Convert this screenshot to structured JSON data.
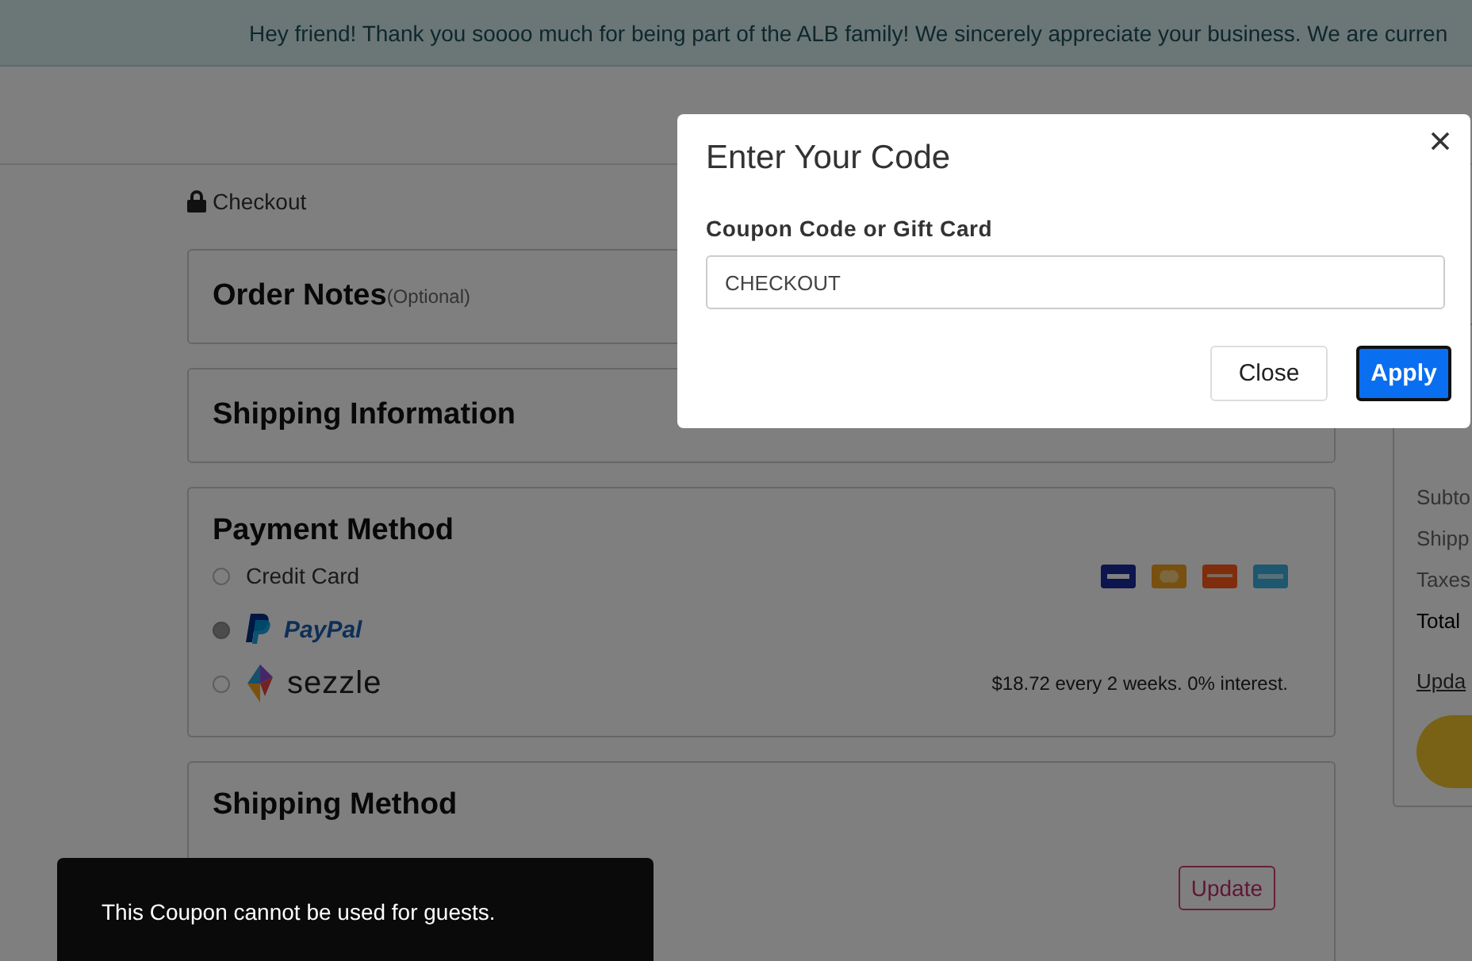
{
  "banner": {
    "text": "Hey friend! Thank you soooo much for being part of the ALB family! We sincerely appreciate your business. We are curren"
  },
  "breadcrumb": {
    "label": "Checkout"
  },
  "sections": [
    {
      "kind": "notes",
      "title": "Order Notes",
      "note": "(Optional)"
    },
    {
      "kind": "plain",
      "title": "Shipping Information"
    },
    {
      "kind": "payment",
      "title": "Payment Method",
      "options": [
        {
          "kind": "card",
          "label": "Credit Card",
          "selected": false
        },
        {
          "kind": "paypal",
          "label": "PayPal",
          "selected": true
        },
        {
          "kind": "sezzle",
          "label": "sezzle",
          "selected": false,
          "info": "$18.72 every 2 weeks. 0% interest."
        }
      ]
    },
    {
      "kind": "shipping",
      "title": "Shipping Method",
      "button": "Update"
    }
  ],
  "summary": {
    "rows": [
      {
        "label": "Subto",
        "strong": false
      },
      {
        "label": "Shipp",
        "strong": false
      },
      {
        "label": "Taxes",
        "strong": false
      },
      {
        "label": "Total",
        "strong": true
      }
    ],
    "link": "Upda"
  },
  "modal": {
    "title": "Enter Your Code",
    "field_label": "Coupon Code or Gift Card",
    "value": "CHECKOUT",
    "buttons": [
      {
        "label": "Close",
        "kind": "secondary"
      },
      {
        "label": "Apply",
        "kind": "primary"
      }
    ]
  },
  "toast": {
    "message": "This Coupon cannot be used for guests."
  }
}
